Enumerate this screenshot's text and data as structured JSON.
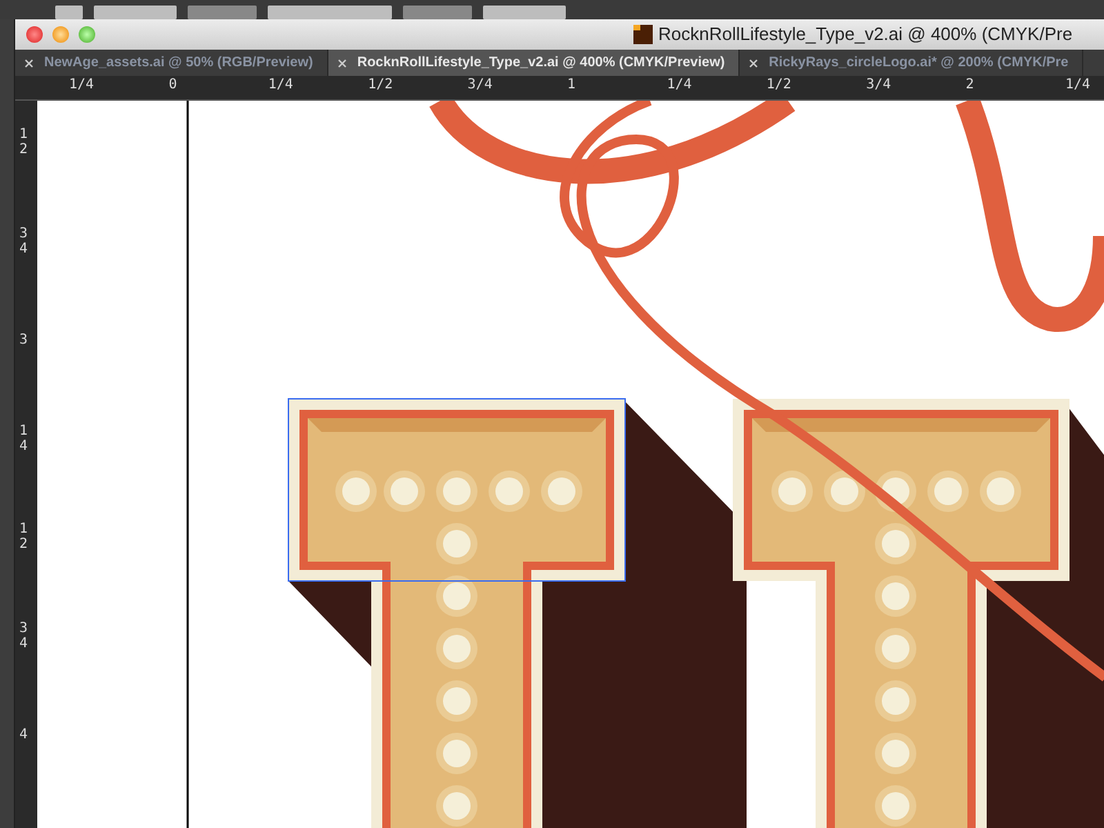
{
  "window": {
    "title": "RocknRollLifestyle_Type_v2.ai @ 400% (CMYK/Pre"
  },
  "tabs": [
    {
      "label": "NewAge_assets.ai @ 50% (RGB/Preview)",
      "selected": false
    },
    {
      "label": "RocknRollLifestyle_Type_v2.ai @ 400% (CMYK/Preview)",
      "selected": true
    },
    {
      "label": "RickyRays_circleLogo.ai* @ 200% (CMYK/Pre",
      "selected": false
    }
  ],
  "horizontal_ruler": [
    "1/4",
    "0",
    "1/4",
    "1/2",
    "3/4",
    "1",
    "1/4",
    "1/2",
    "3/4",
    "2",
    "1/4"
  ],
  "vertical_ruler": [
    [
      "1",
      "2"
    ],
    [
      "3",
      "4"
    ],
    [
      "3"
    ],
    [
      "1",
      "4"
    ],
    [
      "1",
      "2"
    ],
    [
      "3",
      "4"
    ],
    [
      "4"
    ]
  ]
}
